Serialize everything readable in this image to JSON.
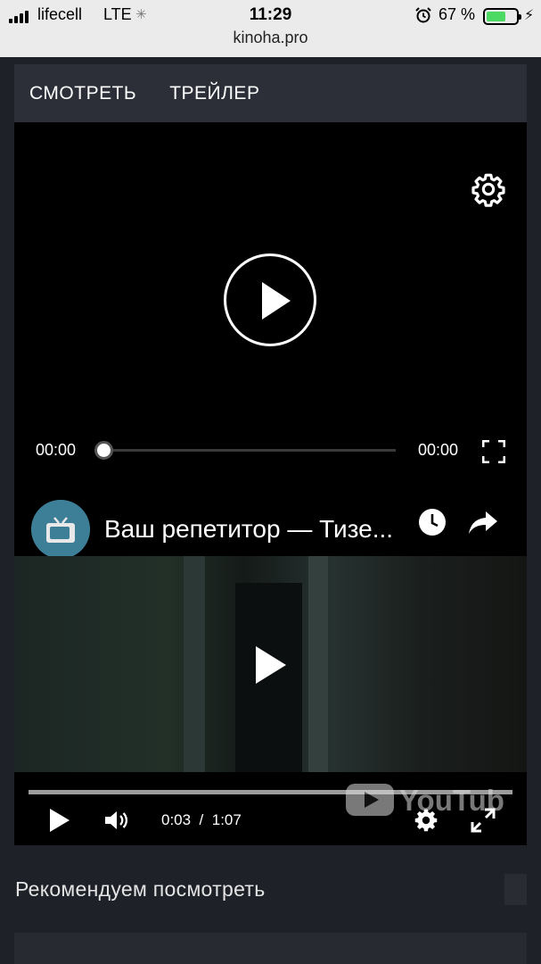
{
  "status": {
    "carrier": "lifecell",
    "network": "LTE",
    "time": "11:29",
    "battery_percent": "67 %",
    "battery_level": 0.67,
    "url": "kinoha.pro"
  },
  "tabs": [
    {
      "label": "СМОТРЕТЬ"
    },
    {
      "label": "ТРЕЙЛЕР"
    }
  ],
  "player": {
    "current_time": "00:00",
    "duration": "00:00",
    "progress": 0
  },
  "youtube": {
    "video_title": "Ваш репетитор — Тизе...",
    "current_time": "0:03",
    "separator": "/",
    "duration": "1:07",
    "logo_text": "YouTube",
    "progress": 0.045
  },
  "section": {
    "recommend_title": "Рекомендуем посмотреть"
  },
  "colors": {
    "page_bg": "#1f2128",
    "tab_bar_bg": "#2c2f38",
    "statusbar_bg": "#ebebeb",
    "battery_green": "#4cd964",
    "yt_avatar": "#3e7f98"
  },
  "icons": [
    "signal-icon",
    "loading-spinner-icon",
    "alarm-icon",
    "battery-icon",
    "charging-bolt-icon",
    "gear-icon",
    "play-icon",
    "fullscreen-icon",
    "clock-icon",
    "share-icon",
    "volume-icon",
    "youtube-logo"
  ]
}
